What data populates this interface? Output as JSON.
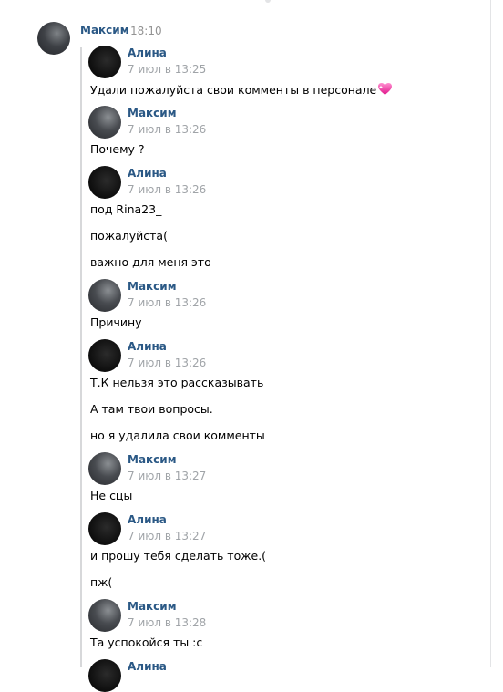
{
  "header": {
    "name": "Максим",
    "time": "18:10"
  },
  "messages": [
    {
      "author": "Алина",
      "date": "7 июл в 13:25",
      "lines": [
        "Удали пожалуйста свои комменты в персонале"
      ]
    },
    {
      "author": "Максим",
      "date": "7 июл в 13:26",
      "lines": [
        "Почему ?"
      ]
    },
    {
      "author": "Алина",
      "date": "7 июл в 13:26",
      "lines": [
        "под Rina23_",
        "пожалуйста(",
        "важно для меня это"
      ]
    },
    {
      "author": "Максим",
      "date": "7 июл в 13:26",
      "lines": [
        "Причину"
      ]
    },
    {
      "author": "Алина",
      "date": "7 июл в 13:26",
      "lines": [
        "Т.К нельзя это рассказывать",
        "А там твои вопросы.",
        "но я удалила свои комменты"
      ]
    },
    {
      "author": "Максим",
      "date": "7 июл в 13:27",
      "lines": [
        "Не сцы"
      ]
    },
    {
      "author": "Алина",
      "date": "7 июл в 13:27",
      "lines": [
        "и прошу тебя сделать тоже.(",
        "пж("
      ]
    },
    {
      "author": "Максим",
      "date": "7 июл в 13:28",
      "lines": [
        "Та успокойся ты :с"
      ]
    },
    {
      "author": "Алина",
      "date": "",
      "lines": []
    }
  ],
  "colors": {
    "name": "#2a5885",
    "time": "#939393",
    "thread_line": "#d7d8da"
  },
  "icons": {
    "heart": "sparkling-heart-emoji"
  }
}
